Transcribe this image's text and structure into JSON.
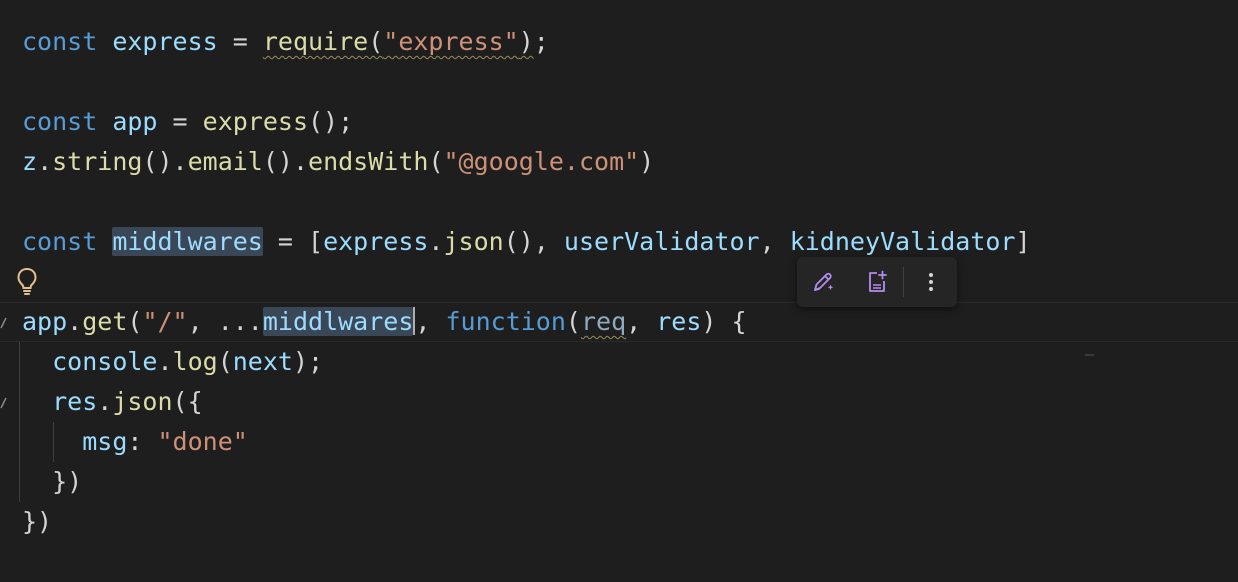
{
  "editor": {
    "language": "javascript",
    "lines": [
      {
        "tokens": [
          {
            "text": "const",
            "kind": "kw"
          },
          {
            "text": " ",
            "kind": "pun"
          },
          {
            "text": "express",
            "kind": "var"
          },
          {
            "text": " = ",
            "kind": "pun"
          },
          {
            "text": "require",
            "kind": "fn",
            "squiggle": true
          },
          {
            "text": "(",
            "kind": "pun",
            "squiggle": true
          },
          {
            "text": "\"express\"",
            "kind": "str",
            "squiggle": true
          },
          {
            "text": ")",
            "kind": "pun",
            "squiggle": true
          },
          {
            "text": ";",
            "kind": "pun"
          }
        ]
      },
      {
        "tokens": []
      },
      {
        "tokens": [
          {
            "text": "const",
            "kind": "kw"
          },
          {
            "text": " ",
            "kind": "pun"
          },
          {
            "text": "app",
            "kind": "var"
          },
          {
            "text": " = ",
            "kind": "pun"
          },
          {
            "text": "express",
            "kind": "fn"
          },
          {
            "text": "();",
            "kind": "pun"
          }
        ]
      },
      {
        "tokens": [
          {
            "text": "z",
            "kind": "var"
          },
          {
            "text": ".",
            "kind": "pun"
          },
          {
            "text": "string",
            "kind": "fn"
          },
          {
            "text": "().",
            "kind": "pun"
          },
          {
            "text": "email",
            "kind": "fn"
          },
          {
            "text": "().",
            "kind": "pun"
          },
          {
            "text": "endsWith",
            "kind": "fn"
          },
          {
            "text": "(",
            "kind": "pun"
          },
          {
            "text": "\"@google.com\"",
            "kind": "str"
          },
          {
            "text": ")",
            "kind": "pun"
          }
        ]
      },
      {
        "tokens": []
      },
      {
        "tokens": [
          {
            "text": "const",
            "kind": "kw"
          },
          {
            "text": " ",
            "kind": "pun"
          },
          {
            "text": "middlwares",
            "kind": "var",
            "highlight": true
          },
          {
            "text": " = [",
            "kind": "pun"
          },
          {
            "text": "express",
            "kind": "var"
          },
          {
            "text": ".",
            "kind": "pun"
          },
          {
            "text": "json",
            "kind": "fn"
          },
          {
            "text": "(), ",
            "kind": "pun"
          },
          {
            "text": "userValidator",
            "kind": "var"
          },
          {
            "text": ", ",
            "kind": "pun"
          },
          {
            "text": "kidneyValidator",
            "kind": "var"
          },
          {
            "text": "]",
            "kind": "pun"
          }
        ]
      },
      {
        "tokens": []
      },
      {
        "tokens": [
          {
            "text": "app",
            "kind": "var"
          },
          {
            "text": ".",
            "kind": "pun"
          },
          {
            "text": "get",
            "kind": "fn"
          },
          {
            "text": "(",
            "kind": "pun"
          },
          {
            "text": "\"/\"",
            "kind": "str"
          },
          {
            "text": ", ...",
            "kind": "pun"
          },
          {
            "text": "middlwares",
            "kind": "var",
            "highlight": true,
            "cursor_after": true
          },
          {
            "text": ", ",
            "kind": "pun"
          },
          {
            "text": "function",
            "kind": "kw"
          },
          {
            "text": "(",
            "kind": "pun"
          },
          {
            "text": "req",
            "kind": "var",
            "squiggle": true,
            "dim": true
          },
          {
            "text": ", ",
            "kind": "pun"
          },
          {
            "text": "res",
            "kind": "var"
          },
          {
            "text": ") {",
            "kind": "pun"
          }
        ]
      },
      {
        "tokens": [
          {
            "text": "  ",
            "kind": "pun"
          },
          {
            "text": "console",
            "kind": "var"
          },
          {
            "text": ".",
            "kind": "pun"
          },
          {
            "text": "log",
            "kind": "fn"
          },
          {
            "text": "(",
            "kind": "pun"
          },
          {
            "text": "next",
            "kind": "var"
          },
          {
            "text": ");",
            "kind": "pun"
          }
        ]
      },
      {
        "tokens": [
          {
            "text": "  ",
            "kind": "pun"
          },
          {
            "text": "res",
            "kind": "var"
          },
          {
            "text": ".",
            "kind": "pun"
          },
          {
            "text": "json",
            "kind": "fn"
          },
          {
            "text": "({",
            "kind": "pun"
          }
        ]
      },
      {
        "tokens": [
          {
            "text": "    ",
            "kind": "pun"
          },
          {
            "text": "msg",
            "kind": "var"
          },
          {
            "text": ": ",
            "kind": "pun"
          },
          {
            "text": "\"done\"",
            "kind": "str"
          }
        ]
      },
      {
        "tokens": [
          {
            "text": "  ",
            "kind": "pun"
          },
          {
            "text": "})",
            "kind": "pun"
          }
        ]
      },
      {
        "tokens": [
          {
            "text": "})",
            "kind": "pun"
          }
        ]
      }
    ]
  },
  "lightbulb": {
    "icon": "lightbulb-icon",
    "color": "#e2c08d"
  },
  "toolbar": {
    "buttons": [
      {
        "icon": "edit-with-ai-icon"
      },
      {
        "icon": "add-to-chat-icon"
      },
      {
        "icon": "more-actions-icon"
      }
    ],
    "icon_color": "#b48cf0"
  }
}
